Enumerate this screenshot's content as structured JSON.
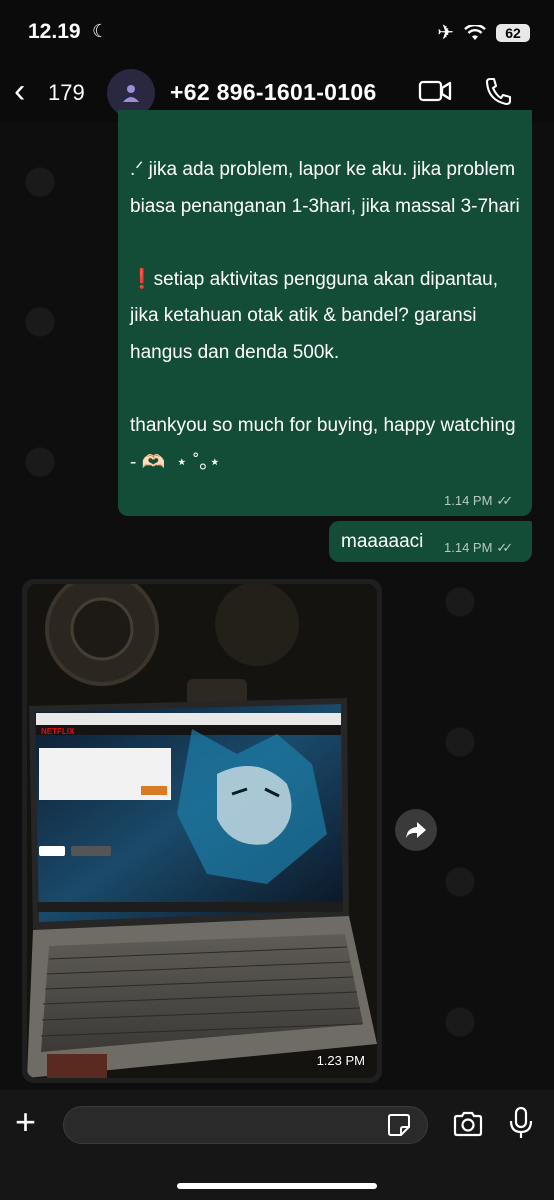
{
  "status_bar": {
    "time": "12.19",
    "battery": "62"
  },
  "header": {
    "back_count": "179",
    "contact_name": "+62 896-1601-0106"
  },
  "messages": [
    {
      "text": ".ᐟ jika ada problem, lapor ke aku. jika problem biasa penanganan 1-3hari, jika massal 3-7hari\n\n❗setiap aktivitas pengguna akan dipantau, jika ketahuan otak atik & bandel? garansi hangus dan denda 500k.\n\nthankyou so much for buying, happy watching - 🫶🏻  ⋆ ˚｡⋆",
      "time": "1.14 PM"
    },
    {
      "text": "maaaaaci",
      "time": "1.14 PM"
    }
  ],
  "photo_message": {
    "time": "1.23 PM"
  },
  "composer": {
    "placeholder": ""
  },
  "colors": {
    "outgoing_bubble": "#144d37",
    "background": "#0b0b0b"
  }
}
